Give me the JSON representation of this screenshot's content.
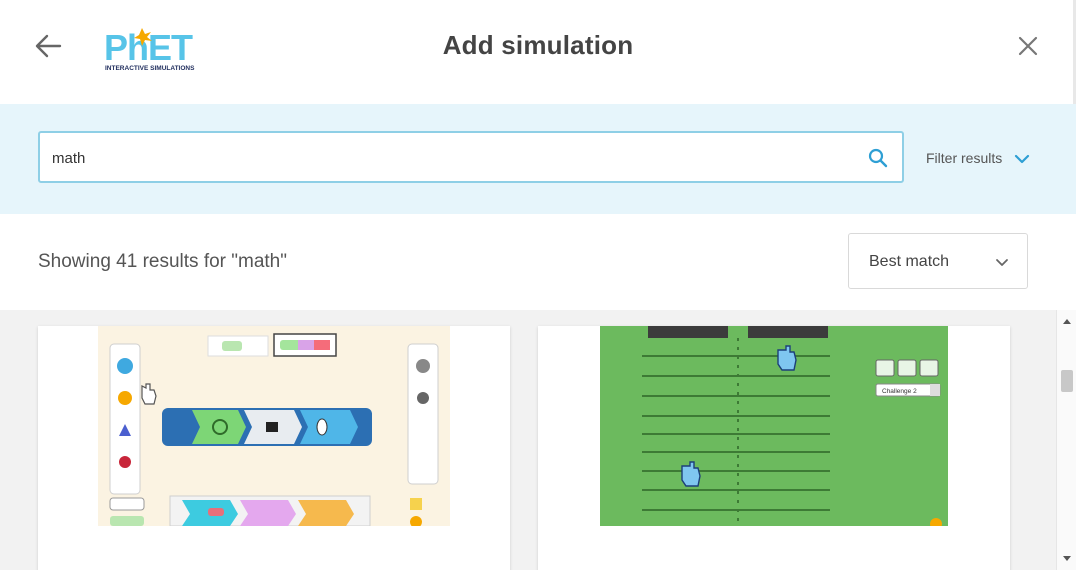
{
  "header": {
    "title": "Add simulation",
    "logo_text": "PhET",
    "logo_subtext": "INTERACTIVE SIMULATIONS",
    "back_icon": "arrow-left-icon",
    "close_icon": "close-icon"
  },
  "search": {
    "value": "math",
    "icon": "search-icon",
    "filter_label": "Filter results",
    "filter_icon": "chevron-down-icon"
  },
  "results": {
    "count_text": "Showing 41 results for \"math\"",
    "sort_value": "Best match",
    "sort_icon": "chevron-down-icon"
  },
  "cards": [
    {
      "thumb_label": "simulation-thumbnail"
    },
    {
      "thumb_label": "simulation-thumbnail",
      "dropdown_text": "Challenge 2"
    }
  ],
  "colors": {
    "accent": "#2e9fd4",
    "band": "#e6f5fb",
    "search_border": "#8ecfe6",
    "green_sim": "#6cba5e"
  }
}
